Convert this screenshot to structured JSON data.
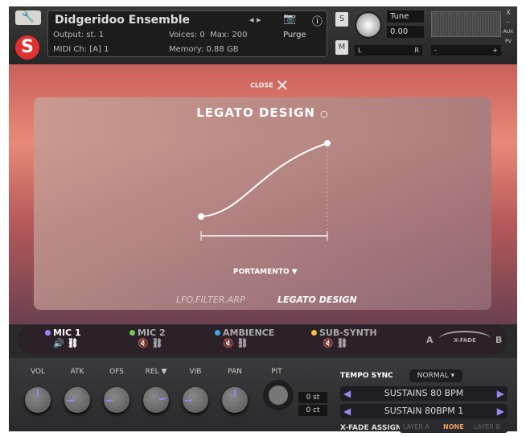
{
  "header": {
    "instrument": "Didgeridoo Ensemble",
    "output_label": "Output:",
    "output_value": "st. 1",
    "voices_label": "Voices:",
    "voices_value": "0",
    "max_label": "Max:",
    "max_value": "200",
    "midi_label": "MIDI Ch:",
    "midi_value": "[A] 1",
    "memory_label": "Memory:",
    "memory_value": "0.88 GB",
    "purge": "Purge",
    "solo": "S",
    "mute": "M",
    "tune_label": "Tune",
    "tune_value": "0.00",
    "pan_l": "L",
    "pan_r": "R",
    "vol_minus": "-",
    "vol_plus": "+",
    "close_x": "X",
    "minimize": "–",
    "aux": "AUX",
    "pv": "PV"
  },
  "overlay": {
    "close": "CLOSE",
    "title": "LEGATO DESIGN",
    "mode": "PORTAMENTO",
    "tabs": [
      {
        "label": "LFO.FILTER.ARP",
        "active": false
      },
      {
        "label": "LEGATO DESIGN",
        "active": true
      }
    ]
  },
  "mics": [
    {
      "name": "MIC 1",
      "color": "#9a86f0",
      "active": true
    },
    {
      "name": "MIC 2",
      "color": "#7ac850",
      "active": false
    },
    {
      "name": "AMBIENCE",
      "color": "#40a8e0",
      "active": false
    },
    {
      "name": "SUB-SYNTH",
      "color": "#f0c040",
      "active": false
    }
  ],
  "xfade": {
    "a": "A",
    "b": "B",
    "label": "X-FADE"
  },
  "knobs": [
    {
      "label": "VOL",
      "value": 0.5
    },
    {
      "label": "ATK",
      "value": 0.15
    },
    {
      "label": "OFS",
      "value": 0.15
    },
    {
      "label": "REL ▼",
      "value": 0.8
    },
    {
      "label": "VIB",
      "value": 0.15
    },
    {
      "label": "PAN",
      "value": 0.5
    }
  ],
  "pitch": {
    "label": "PIT",
    "semitones": "0 st",
    "cents": "0 ct"
  },
  "tempo_sync": {
    "label": "TEMPO SYNC",
    "value": "NORMAL ▾"
  },
  "articulations": [
    "SUSTAINS 80 BPM",
    "SUSTAIN 80BPM 1"
  ],
  "xfade_assign": {
    "label": "X-FADE ASSIGN",
    "options": [
      "LAYER A",
      "NONE",
      "LAYER B"
    ],
    "selected": "NONE"
  },
  "accent": "#9a86f0"
}
